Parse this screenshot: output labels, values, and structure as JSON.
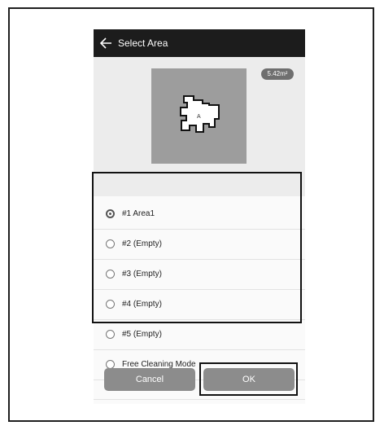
{
  "appbar": {
    "back_icon": "arrow-left-icon",
    "title": "Select Area"
  },
  "map": {
    "area_badge": "5.42m²",
    "room_label": "A"
  },
  "areas": [
    {
      "label": "#1 Area1",
      "selected": true
    },
    {
      "label": "#2 (Empty)",
      "selected": false
    },
    {
      "label": "#3 (Empty)",
      "selected": false
    },
    {
      "label": "#4 (Empty)",
      "selected": false
    },
    {
      "label": "#5 (Empty)",
      "selected": false
    }
  ],
  "free_mode": {
    "label": "Free Cleaning Mode",
    "selected": false
  },
  "buttons": {
    "cancel": "Cancel",
    "ok": "OK"
  },
  "colors": {
    "appbar": "#1c1c1c",
    "map_tile": "#9d9d9d",
    "button": "#8c8c8c"
  }
}
